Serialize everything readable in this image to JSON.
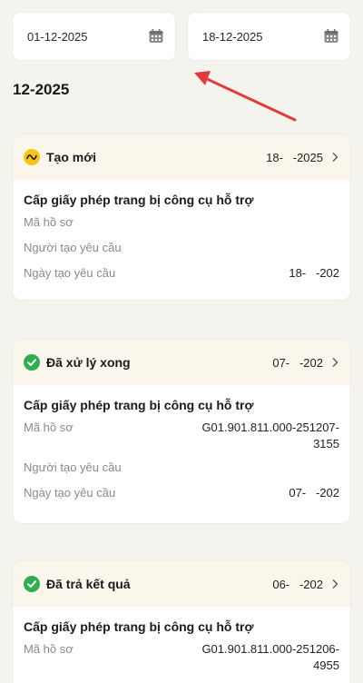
{
  "date_filter": {
    "from": "01-12-2025",
    "to": "18-12-2025",
    "icon": "calendar-icon"
  },
  "month_heading": "12-2025",
  "cards": [
    {
      "status": "Tạo mới",
      "status_color": "#f5c518",
      "status_icon": "pending-icon",
      "date": "18-   -2025",
      "title": "Cấp giấy phép trang bị công cụ hỗ trợ",
      "fields": [
        {
          "label": "Mã hồ sơ",
          "value": ""
        },
        {
          "label": "Người tạo yêu cầu",
          "value": ""
        },
        {
          "label": "Ngày tạo yêu cầu",
          "value": "18-   -202"
        }
      ]
    },
    {
      "status": "Đã xử lý xong",
      "status_color": "#2eae4f",
      "status_icon": "check-circle-icon",
      "date": "07-   -202",
      "title": "Cấp giấy phép trang bị công cụ hỗ trợ",
      "fields": [
        {
          "label": "Mã hồ sơ",
          "value": "G01.901.811.000-251207-3155"
        },
        {
          "label": "Người tạo yêu cầu",
          "value": ""
        },
        {
          "label": "Ngày tạo yêu cầu",
          "value": "07-   -202"
        }
      ]
    },
    {
      "status": "Đã trả kết quả",
      "status_color": "#2eae4f",
      "status_icon": "check-circle-icon",
      "date": "06-   -202",
      "title": "Cấp giấy phép trang bị công cụ hỗ trợ",
      "fields": [
        {
          "label": "Mã hồ sơ",
          "value": "G01.901.811.000-251206-4955"
        }
      ]
    }
  ],
  "annotation_color": "#e23b3b"
}
